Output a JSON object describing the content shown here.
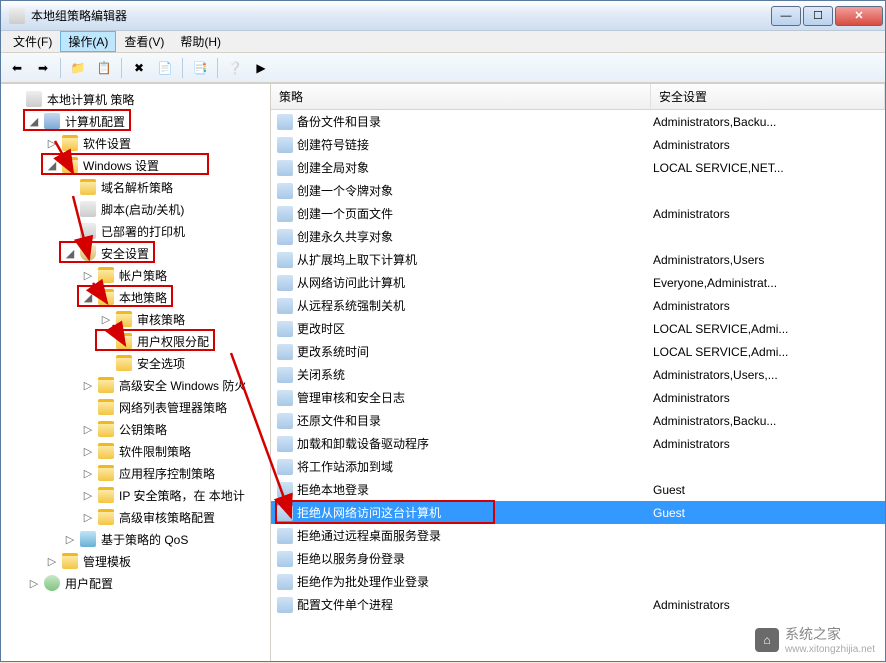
{
  "window": {
    "title": "本地组策略编辑器"
  },
  "menubar": {
    "items": [
      {
        "label": "文件(F)",
        "highlighted": false
      },
      {
        "label": "操作(A)",
        "highlighted": true
      },
      {
        "label": "查看(V)",
        "highlighted": false
      },
      {
        "label": "帮助(H)",
        "highlighted": false
      }
    ]
  },
  "toolbar": {
    "buttons": [
      {
        "name": "back-icon",
        "glyph": "⬅"
      },
      {
        "name": "forward-icon",
        "glyph": "➡"
      },
      {
        "name": "sep"
      },
      {
        "name": "up-icon",
        "glyph": "📁"
      },
      {
        "name": "properties-icon",
        "glyph": "📋"
      },
      {
        "name": "sep"
      },
      {
        "name": "delete-icon",
        "glyph": "✖"
      },
      {
        "name": "refresh-icon",
        "glyph": "📄"
      },
      {
        "name": "sep"
      },
      {
        "name": "export-icon",
        "glyph": "📑"
      },
      {
        "name": "sep"
      },
      {
        "name": "help-icon",
        "glyph": "❔"
      },
      {
        "name": "run-icon",
        "glyph": "▶"
      }
    ]
  },
  "tree": [
    {
      "depth": 0,
      "toggle": "",
      "icon": "script-icon",
      "label": "本地计算机 策略",
      "redbox": false
    },
    {
      "depth": 1,
      "toggle": "◢",
      "icon": "computer-icon",
      "label": "计算机配置",
      "redbox": true
    },
    {
      "depth": 2,
      "toggle": "▷",
      "icon": "folder-icon",
      "label": "软件设置",
      "redbox": false
    },
    {
      "depth": 2,
      "toggle": "◢",
      "icon": "folder-icon",
      "label": "Windows 设置",
      "redbox": true
    },
    {
      "depth": 3,
      "toggle": "",
      "icon": "folder-icon",
      "label": "域名解析策略",
      "redbox": false
    },
    {
      "depth": 3,
      "toggle": "",
      "icon": "script-icon",
      "label": "脚本(启动/关机)",
      "redbox": false
    },
    {
      "depth": 3,
      "toggle": "",
      "icon": "script-icon",
      "label": "已部署的打印机",
      "redbox": false
    },
    {
      "depth": 3,
      "toggle": "◢",
      "icon": "lock-icon",
      "label": "安全设置",
      "redbox": true
    },
    {
      "depth": 4,
      "toggle": "▷",
      "icon": "folder-icon",
      "label": "帐户策略",
      "redbox": false
    },
    {
      "depth": 4,
      "toggle": "◢",
      "icon": "folder-icon",
      "label": "本地策略",
      "redbox": true
    },
    {
      "depth": 5,
      "toggle": "▷",
      "icon": "folder-icon",
      "label": "审核策略",
      "redbox": false
    },
    {
      "depth": 5,
      "toggle": "",
      "icon": "folder-icon",
      "label": "用户权限分配",
      "redbox": true
    },
    {
      "depth": 5,
      "toggle": "",
      "icon": "folder-icon",
      "label": "安全选项",
      "redbox": false
    },
    {
      "depth": 4,
      "toggle": "▷",
      "icon": "folder-icon",
      "label": "高级安全 Windows 防火",
      "redbox": false
    },
    {
      "depth": 4,
      "toggle": "",
      "icon": "folder-icon",
      "label": "网络列表管理器策略",
      "redbox": false
    },
    {
      "depth": 4,
      "toggle": "▷",
      "icon": "folder-icon",
      "label": "公钥策略",
      "redbox": false
    },
    {
      "depth": 4,
      "toggle": "▷",
      "icon": "folder-icon",
      "label": "软件限制策略",
      "redbox": false
    },
    {
      "depth": 4,
      "toggle": "▷",
      "icon": "folder-icon",
      "label": "应用程序控制策略",
      "redbox": false
    },
    {
      "depth": 4,
      "toggle": "▷",
      "icon": "folder-icon",
      "label": "IP 安全策略，在 本地计",
      "redbox": false
    },
    {
      "depth": 4,
      "toggle": "▷",
      "icon": "folder-icon",
      "label": "高级审核策略配置",
      "redbox": false
    },
    {
      "depth": 3,
      "toggle": "▷",
      "icon": "chart-icon",
      "label": "基于策略的 QoS",
      "redbox": false
    },
    {
      "depth": 2,
      "toggle": "▷",
      "icon": "folder-icon",
      "label": "管理模板",
      "redbox": false
    },
    {
      "depth": 1,
      "toggle": "▷",
      "icon": "user-icon",
      "label": "用户配置",
      "redbox": false
    }
  ],
  "list": {
    "headers": {
      "policy": "策略",
      "setting": "安全设置"
    },
    "rows": [
      {
        "policy": "备份文件和目录",
        "setting": "Administrators,Backu...",
        "selected": false
      },
      {
        "policy": "创建符号链接",
        "setting": "Administrators",
        "selected": false
      },
      {
        "policy": "创建全局对象",
        "setting": "LOCAL SERVICE,NET...",
        "selected": false
      },
      {
        "policy": "创建一个令牌对象",
        "setting": "",
        "selected": false
      },
      {
        "policy": "创建一个页面文件",
        "setting": "Administrators",
        "selected": false
      },
      {
        "policy": "创建永久共享对象",
        "setting": "",
        "selected": false
      },
      {
        "policy": "从扩展坞上取下计算机",
        "setting": "Administrators,Users",
        "selected": false
      },
      {
        "policy": "从网络访问此计算机",
        "setting": "Everyone,Administrat...",
        "selected": false
      },
      {
        "policy": "从远程系统强制关机",
        "setting": "Administrators",
        "selected": false
      },
      {
        "policy": "更改时区",
        "setting": "LOCAL SERVICE,Admi...",
        "selected": false
      },
      {
        "policy": "更改系统时间",
        "setting": "LOCAL SERVICE,Admi...",
        "selected": false
      },
      {
        "policy": "关闭系统",
        "setting": "Administrators,Users,...",
        "selected": false
      },
      {
        "policy": "管理审核和安全日志",
        "setting": "Administrators",
        "selected": false
      },
      {
        "policy": "还原文件和目录",
        "setting": "Administrators,Backu...",
        "selected": false
      },
      {
        "policy": "加载和卸载设备驱动程序",
        "setting": "Administrators",
        "selected": false
      },
      {
        "policy": "将工作站添加到域",
        "setting": "",
        "selected": false
      },
      {
        "policy": "拒绝本地登录",
        "setting": "Guest",
        "selected": false
      },
      {
        "policy": "拒绝从网络访问这台计算机",
        "setting": "Guest",
        "selected": true,
        "redbox": true
      },
      {
        "policy": "拒绝通过远程桌面服务登录",
        "setting": "",
        "selected": false
      },
      {
        "policy": "拒绝以服务身份登录",
        "setting": "",
        "selected": false
      },
      {
        "policy": "拒绝作为批处理作业登录",
        "setting": "",
        "selected": false
      },
      {
        "policy": "配置文件单个进程",
        "setting": "Administrators",
        "selected": false
      }
    ]
  },
  "watermark": {
    "brand": "系统之家",
    "url": "www.xitongzhijia.net"
  }
}
